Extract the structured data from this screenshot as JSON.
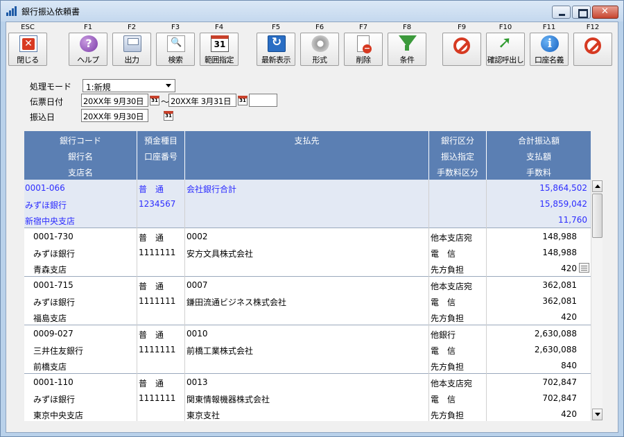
{
  "window": {
    "title": "銀行振込依頼書"
  },
  "fkeys": [
    {
      "key": "ESC",
      "label": "閉じる",
      "icon": "exit-icon"
    },
    {
      "key": "F1",
      "label": "ヘルプ",
      "icon": "help-icon"
    },
    {
      "key": "F2",
      "label": "出力",
      "icon": "print-icon"
    },
    {
      "key": "F3",
      "label": "検索",
      "icon": "search-icon"
    },
    {
      "key": "F4",
      "label": "範囲指定",
      "icon": "calendar-icon"
    },
    {
      "key": "F5",
      "label": "最新表示",
      "icon": "refresh-icon"
    },
    {
      "key": "F6",
      "label": "形式",
      "icon": "gear-icon"
    },
    {
      "key": "F7",
      "label": "削除",
      "icon": "delete-doc-icon"
    },
    {
      "key": "F8",
      "label": "条件",
      "icon": "filter-icon"
    },
    {
      "key": "F9",
      "label": "",
      "icon": "disabled-icon"
    },
    {
      "key": "F10",
      "label": "確認呼出し",
      "icon": "arrow-icon"
    },
    {
      "key": "F11",
      "label": "口座名義",
      "icon": "info-icon"
    },
    {
      "key": "F12",
      "label": "",
      "icon": "disabled-icon"
    }
  ],
  "form": {
    "mode_label": "処理モード",
    "mode_value": "1:新規",
    "slip_date_label": "伝票日付",
    "slip_date_from": "20XX年 9月30日",
    "range_sep": "～",
    "slip_date_to": "20XX年 3月31日",
    "transfer_date_label": "振込日",
    "transfer_date": "20XX年 9月30日"
  },
  "grid": {
    "headers": [
      [
        "銀行コード",
        "銀行名",
        "支店名"
      ],
      [
        "預金種目",
        "口座番号",
        ""
      ],
      [
        "支払先",
        "",
        ""
      ],
      [
        "銀行区分",
        "振込指定",
        "手数料区分"
      ],
      [
        "合計振込額",
        "支払額",
        "手数料"
      ]
    ],
    "summary": {
      "bank_code": "0001-066",
      "bank_name": "みずほ銀行",
      "branch": "新宿中央支店",
      "account_type": "普　通",
      "account_no": "1234567",
      "payee": "会社銀行合計",
      "total": "15,864,502",
      "paid": "15,859,042",
      "fee": "11,760"
    },
    "rows": [
      {
        "bank_code": "0001-730",
        "bank_name": "みずほ銀行",
        "branch": "青森支店",
        "account_type": "普　通",
        "account_no": "1111111",
        "payee_code": "0002",
        "payee_name": "安方文具株式会社",
        "payee_extra": "",
        "bank_class": "他本支店宛",
        "transfer": "電　信",
        "fee_class": "先方負担",
        "total": "148,988",
        "paid": "148,988",
        "fee": "420"
      },
      {
        "bank_code": "0001-715",
        "bank_name": "みずほ銀行",
        "branch": "福島支店",
        "account_type": "普　通",
        "account_no": "1111111",
        "payee_code": "0007",
        "payee_name": "鎌田流通ビジネス株式会社",
        "payee_extra": "",
        "bank_class": "他本支店宛",
        "transfer": "電　信",
        "fee_class": "先方負担",
        "total": "362,081",
        "paid": "362,081",
        "fee": "420"
      },
      {
        "bank_code": "0009-027",
        "bank_name": "三井住友銀行",
        "branch": "前橋支店",
        "account_type": "普　通",
        "account_no": "1111111",
        "payee_code": "0010",
        "payee_name": "前橋工業株式会社",
        "payee_extra": "",
        "bank_class": "他銀行",
        "transfer": "電　信",
        "fee_class": "先方負担",
        "total": "2,630,088",
        "paid": "2,630,088",
        "fee": "840"
      },
      {
        "bank_code": "0001-110",
        "bank_name": "みずほ銀行",
        "branch": "東京中央支店",
        "account_type": "普　通",
        "account_no": "1111111",
        "payee_code": "0013",
        "payee_name": "関東情報機器株式会社",
        "payee_extra": "東京支社",
        "bank_class": "他本支店宛",
        "transfer": "電　信",
        "fee_class": "先方負担",
        "total": "702,847",
        "paid": "702,847",
        "fee": "420"
      }
    ]
  }
}
